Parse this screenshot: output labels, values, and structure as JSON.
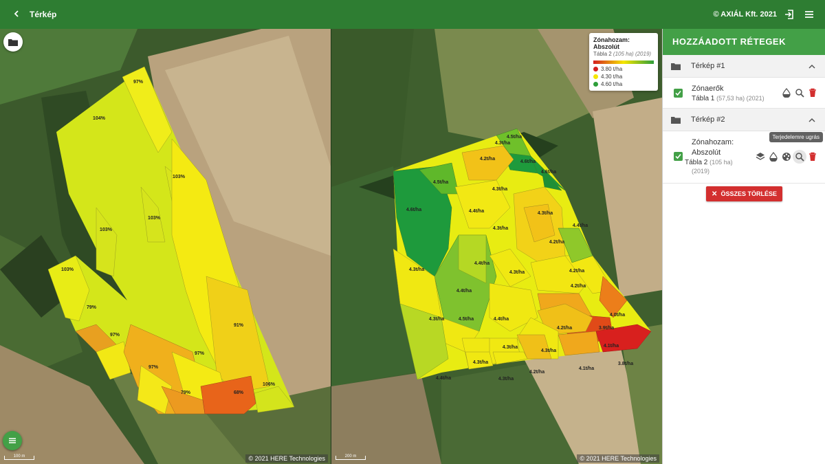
{
  "topbar": {
    "back_icon": "arrow-back-icon",
    "title": "Térkép",
    "copyright": "© AXIÁL Kft. 2021",
    "logout_icon": "logout-icon",
    "menu_icon": "hamburger-menu-icon"
  },
  "maps": {
    "left": {
      "attribution": "© 2021 HERE Technologies",
      "scale": "100 m",
      "zones": [
        "104%",
        "97%",
        "103%",
        "103%",
        "103%",
        "103%",
        "79%",
        "97%",
        "97%",
        "97%",
        "91%",
        "79%",
        "68%",
        "106%"
      ]
    },
    "right": {
      "attribution": "© 2021 HERE Technologies",
      "scale": "200 m",
      "zones": [
        "4.5t/ha",
        "4.3t/ha",
        "4.2t/ha",
        "4.6t/ha",
        "4.6t/ha",
        "4.5t/ha",
        "4.3t/ha",
        "4.6t/ha",
        "4.4t/ha",
        "4.3t/ha",
        "4.4t/ha",
        "4.2t/ha",
        "4.3t/ha",
        "4.4t/ha",
        "4.3t/ha",
        "4.2t/ha",
        "4.3t/ha",
        "4.4t/ha",
        "4.2t/ha",
        "4.5t/ha",
        "4.3t/ha",
        "4.4t/ha",
        "4.0t/ha",
        "4.2t/ha",
        "3.9t/ha",
        "4.3t/ha",
        "4.3t/ha",
        "4.1t/ha",
        "4.3t/ha",
        "4.2t/ha",
        "4.1t/ha",
        "3.8t/ha",
        "4.4t/ha",
        "4.3t/ha"
      ]
    }
  },
  "legend": {
    "title": "Zónahozam: Abszolút",
    "subtitle_field": "Tábla 2",
    "subtitle_meta": "(105 ha) (2019)",
    "items": [
      {
        "label": "3.80 t/ha",
        "color": "#d42020"
      },
      {
        "label": "4.30 t/ha",
        "color": "#f5e600"
      },
      {
        "label": "4.60 t/ha",
        "color": "#2e9e3a"
      }
    ]
  },
  "panel": {
    "title": "HOZZÁADOTT RÉTEGEK",
    "groups": [
      {
        "label": "Térkép #1"
      },
      {
        "label": "Térkép #2"
      }
    ],
    "layers": [
      {
        "name": "Zónaerők",
        "field": "Tábla 1",
        "meta": "(57,53 ha) (2021)"
      },
      {
        "name_line1": "Zónahozam:",
        "name_line2": "Abszolút",
        "field": "Tábla 2",
        "meta1": "(105 ha)",
        "meta2": "(2019)"
      }
    ],
    "tooltip": "Terjedelemre ugrás",
    "clear_all": "ÖSSZES TÖRLÉSE"
  },
  "colors": {
    "primary": "#2e7d32",
    "accent": "#43a047",
    "danger": "#d32f2f"
  }
}
